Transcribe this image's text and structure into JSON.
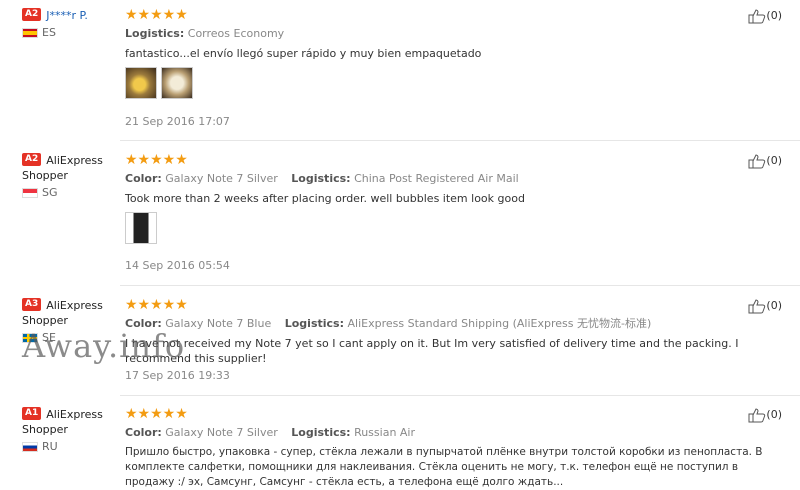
{
  "colors": {
    "star": "#f39c12",
    "a2_badge": "#e43225",
    "a3_badge": "#e43225",
    "a1_badge": "#e43225",
    "link": "#1a5fb4"
  },
  "reviews": [
    {
      "level": "A2",
      "buyer": "J****r P.",
      "country": "ES",
      "flag": "flag-es-icon",
      "stars": "★★★★★",
      "logistics_label": "Logistics:",
      "logistics": "Correos Economy",
      "text": "fantastico...el envío llegó super rápido y muy bien empaquetado",
      "date": "21 Sep 2016 17:07",
      "helpful": "(0)"
    },
    {
      "level": "A2",
      "buyer": "AliExpress Shopper",
      "country": "SG",
      "flag": "flag-sg-icon",
      "stars": "★★★★★",
      "color_label": "Color:",
      "color": "Galaxy Note 7 Silver",
      "logistics_label": "Logistics:",
      "logistics": "China Post Registered Air Mail",
      "text": "Took more than 2 weeks after placing order. well bubbles item look good",
      "date": "14 Sep 2016 05:54",
      "helpful": "(0)"
    },
    {
      "level": "A3",
      "buyer": "AliExpress Shopper",
      "country": "SE",
      "flag": "flag-se-icon",
      "stars": "★★★★★",
      "color_label": "Color:",
      "color": "Galaxy Note 7 Blue",
      "logistics_label": "Logistics:",
      "logistics": "AliExpress Standard Shipping (AliExpress 无忧物流-标准)",
      "text": "I have not received my Note 7 yet so I cant apply on it. But Im very satisfied of delivery time and the packing. I recommend this supplier!",
      "date": "17 Sep 2016 19:33",
      "helpful": "(0)"
    },
    {
      "level": "A1",
      "buyer": "AliExpress Shopper",
      "country": "RU",
      "flag": "flag-ru-icon",
      "stars": "★★★★★",
      "color_label": "Color:",
      "color": "Galaxy Note 7 Silver",
      "logistics_label": "Logistics:",
      "logistics": "Russian Air",
      "text": "Пришло быстро, упаковка - супер, стёкла лежали в пупырчатой плёнке внутри толстой коробки из пенопласта. В комплекте салфетки, помощники для наклеивания. Стёкла оценить не могу, т.к. телефон ещё не поступил в продажу :/ эх, Самсунг, Самсунг - стёкла есть, а телефона ещё долго ждать...",
      "helpful": "(0)"
    }
  ],
  "watermark": "Away.info"
}
